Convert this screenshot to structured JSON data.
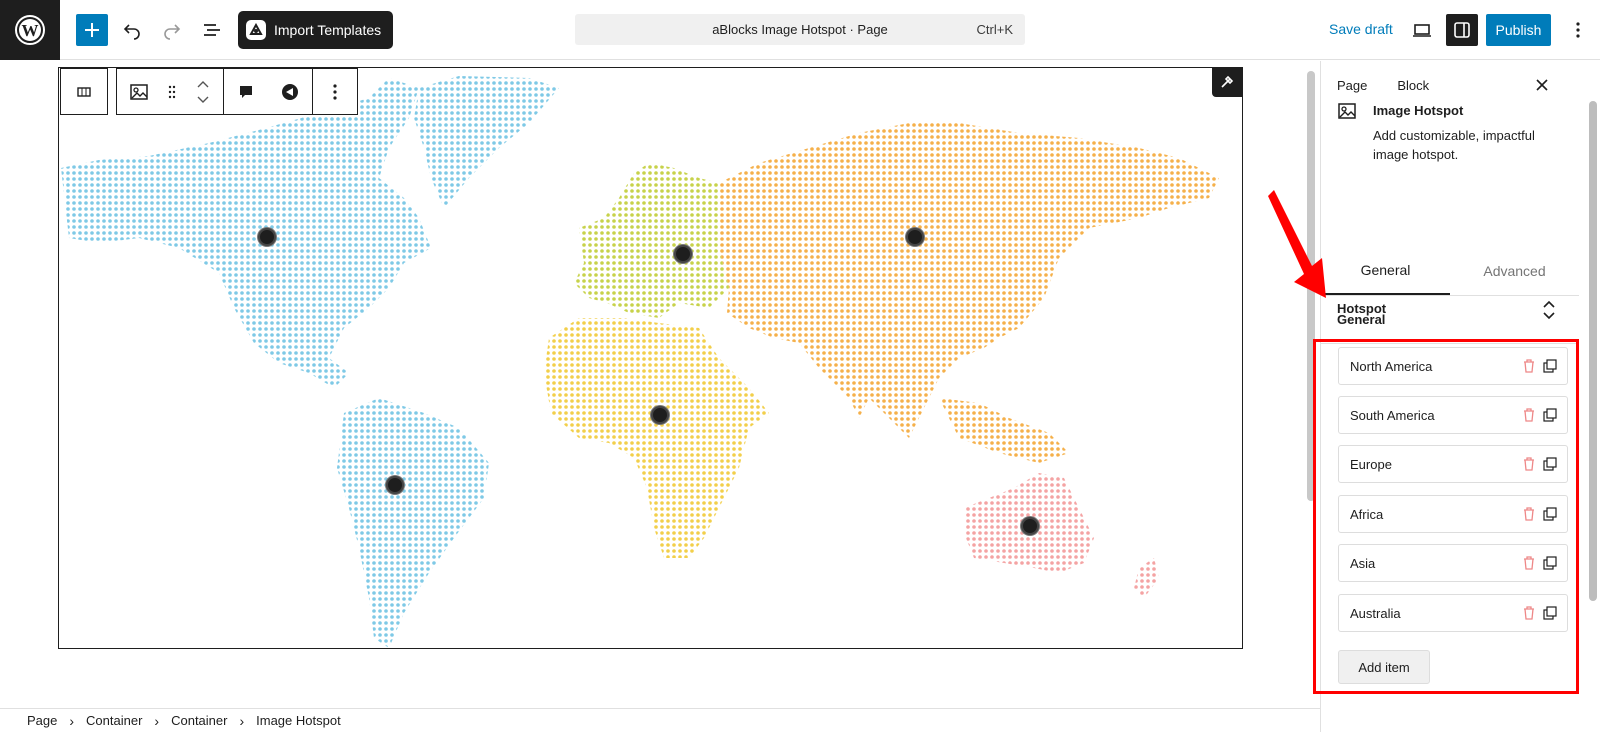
{
  "colors": {
    "accent": "#007cba",
    "dark": "#1e1e1e",
    "highlight": "#ff0000",
    "north_america": "#7ec9e6",
    "south_america": "#7ec9e6",
    "europe": "#c7d24a",
    "asia": "#f5b04a",
    "africa": "#f2cf4a",
    "australia": "#f4a3a3"
  },
  "topbar": {
    "import_label": "Import Templates",
    "doc_title": "aBlocks Image Hotspot · Page",
    "shortcut": "Ctrl+K",
    "save_draft": "Save draft",
    "publish": "Publish"
  },
  "sidebar": {
    "tabs": [
      "Page",
      "Block"
    ],
    "block": {
      "title": "Image Hotspot",
      "description": "Add customizable, impactful image hotspot."
    },
    "gen_tabs": [
      "General",
      "Advanced"
    ],
    "panels": {
      "general": "General",
      "hotspot": "Hotspot"
    },
    "hotspot_items": [
      "North America",
      "South America",
      "Europe",
      "Africa",
      "Asia",
      "Australia"
    ],
    "add_item": "Add item"
  },
  "breadcrumb": [
    "Page",
    "Container",
    "Container",
    "Image Hotspot"
  ]
}
